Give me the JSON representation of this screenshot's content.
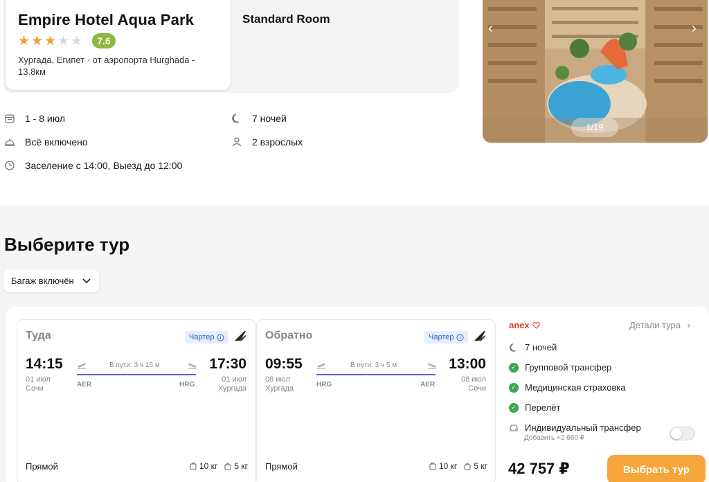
{
  "hotel": {
    "name": "Empire Hotel Aqua Park",
    "stars": 3,
    "max_stars": 5,
    "rating": "7.6",
    "location": "Хургада, Египет · от аэропорта Hurghada - 13.8км",
    "room": "Standard Room"
  },
  "gallery": {
    "counter": "1/19"
  },
  "info": {
    "dates": "1 - 8 июл",
    "nights": "7 ночей",
    "meal": "Всё включено",
    "guests": "2 взрослых",
    "checkin": "Заселение с 14:00, Выезд до 12:00"
  },
  "section_title": "Выберите тур",
  "filter": {
    "label": "Багаж включён"
  },
  "flights": [
    {
      "direction": "Туда",
      "charter": "Чартер",
      "dep_time": "14:15",
      "dep_date": "01 июл",
      "dep_city": "Сочи",
      "duration": "В пути: 3 ч 15 м",
      "dep_code": "AER",
      "arr_code": "HRG",
      "arr_time": "17:30",
      "arr_date": "01 июл",
      "arr_city": "Хургада",
      "type": "Прямой",
      "bag1": "10 кг",
      "bag2": "5 кг"
    },
    {
      "direction": "Обратно",
      "charter": "Чартер",
      "dep_time": "09:55",
      "dep_date": "08 июл",
      "dep_city": "Хургада",
      "duration": "В пути: 3 ч 5 м",
      "dep_code": "HRG",
      "arr_code": "AER",
      "arr_time": "13:00",
      "arr_date": "08 июл",
      "arr_city": "Сочи",
      "type": "Прямой",
      "bag1": "10 кг",
      "bag2": "5 кг"
    }
  ],
  "tour": {
    "operator": "anex",
    "details": "Детали тура",
    "nights": "7 ночей",
    "features": [
      "Групповой трансфер",
      "Медицинская страховка",
      "Перелёт"
    ],
    "individual_transfer": "Индивидуальный трансфер",
    "individual_price": "Добавить +2 660 ₽",
    "price": "42 757 ₽",
    "button": "Выбрать тур"
  },
  "colors": {
    "accent": "#f5a53a",
    "rating": "#8cb83e",
    "star": "#f2a12e",
    "check": "#3aa650",
    "operator": "#e33a2c",
    "charter": "#2f5fd0"
  }
}
